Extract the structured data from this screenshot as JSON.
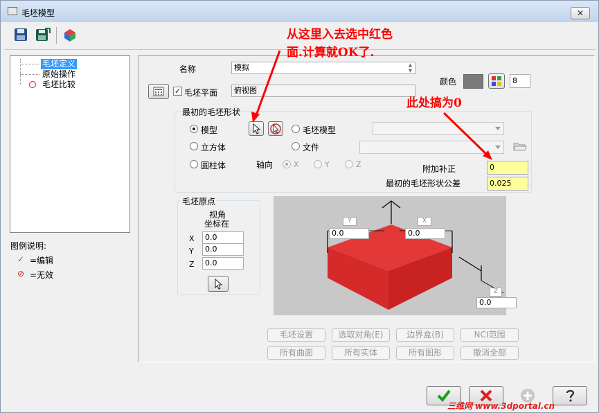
{
  "window": {
    "title": "毛坯模型",
    "close_label": "✕"
  },
  "toolbar": {
    "save_icon": "save-icon",
    "save_as_icon": "save-as-icon",
    "stock_icon": "stock-model-icon"
  },
  "tree": {
    "items": [
      "毛坯定义",
      "原始操作",
      "毛坯比较"
    ]
  },
  "legend": {
    "title": "图例说明:",
    "items": [
      {
        "symbol": "✓",
        "label": "=编辑"
      },
      {
        "symbol": "⊘",
        "label": "=无效"
      }
    ]
  },
  "form": {
    "name_label": "名称",
    "name_value": "模拟",
    "color_label": "颜色",
    "color_value": "8",
    "color_swatch": "#7a7a7a",
    "stock_plane_label": "毛坯平面",
    "stock_plane_value": "俯视图",
    "initial_shape_group": "最初的毛坯形状",
    "radio_model": "模型",
    "radio_stock_model": "毛坯模型",
    "radio_box": "立方体",
    "radio_file": "文件",
    "radio_cylinder": "圆柱体",
    "axis_label": "轴向",
    "axis_x": "X",
    "axis_y": "Y",
    "axis_z": "Z",
    "extra_offset_label": "附加补正",
    "extra_offset_value": "0",
    "tolerance_label": "最初的毛坯形状公差",
    "tolerance_value": "0.025",
    "origin_group": "毛坯原点",
    "view_label_1": "视角",
    "view_label_2": "坐标在",
    "origin_x_label": "X",
    "origin_y_label": "Y",
    "origin_z_label": "Z",
    "origin_x": "0.0",
    "origin_y": "0.0",
    "origin_z": "0.0"
  },
  "preview": {
    "tag_y": "Y",
    "tag_x": "X",
    "tag_z": "Z",
    "val_y": "0.0",
    "val_x": "0.0",
    "val_z": "0.0",
    "stock_color": "#e03030"
  },
  "buttons": {
    "stock_setup": "毛坯设置",
    "select_corners": "选取对角(E)",
    "bounding_box": "边界盒(B)",
    "nci_range": "NCI范围",
    "all_surfaces": "所有曲面",
    "all_solids": "所有实体",
    "all_entities": "所有图形",
    "deselect_all": "撤消全部"
  },
  "annotations": {
    "note1_line1": "从这里入去选中红色",
    "note1_line2": "面.计算就OK了.",
    "note2": "此处搞为0",
    "color": "#ff0000"
  },
  "footer": {
    "ok_icon": "check-icon",
    "cancel_icon": "cancel-x-icon",
    "add_icon": "plus-icon",
    "help_icon": "help-icon",
    "watermark": "三维网 www.3dportal.cn"
  }
}
